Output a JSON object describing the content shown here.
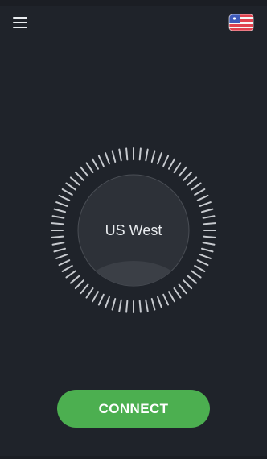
{
  "header": {
    "menu_icon": "hamburger-menu-icon",
    "flag_icon": "us-flag-icon"
  },
  "server": {
    "location_label": "US West"
  },
  "actions": {
    "connect_label": "CONNECT"
  },
  "colors": {
    "background": "#1f232a",
    "accent": "#4caf50",
    "dial_ticks": "#c7cacf",
    "inner_circle": "#2d3138",
    "inner_circle_bottom": "#3b3f46",
    "text": "#e9ecef"
  }
}
